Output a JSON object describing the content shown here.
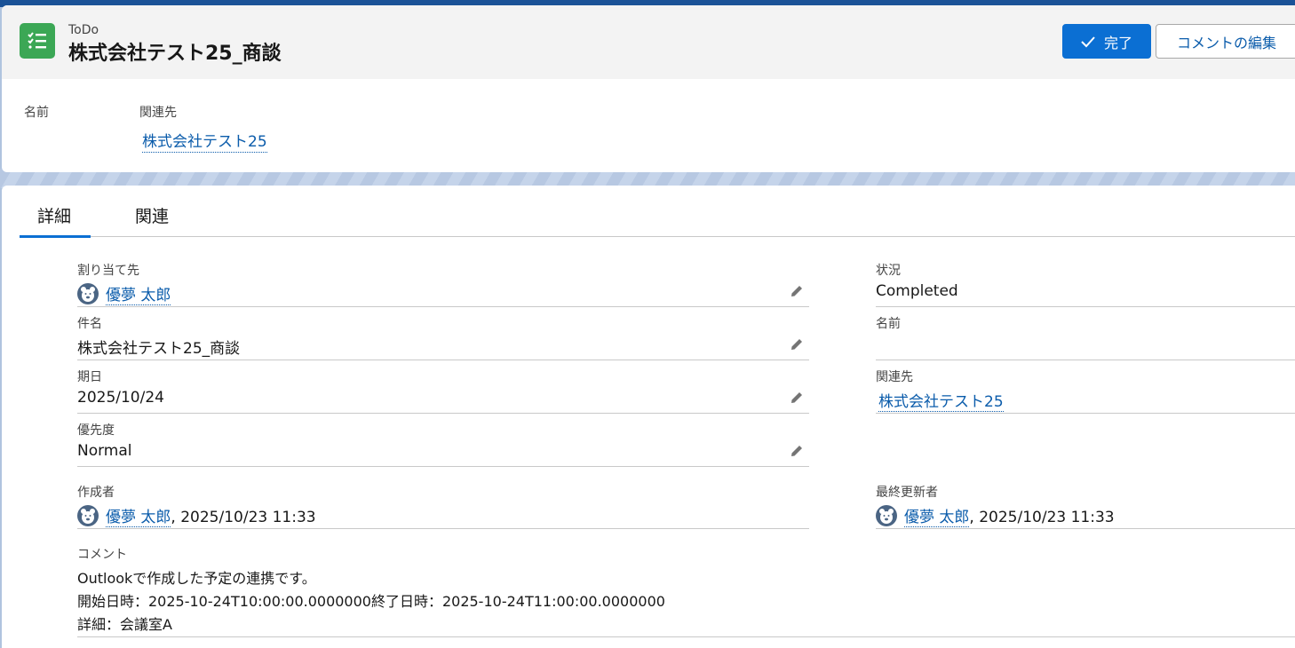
{
  "header": {
    "object_label": "ToDo",
    "title": "株式会社テスト25_商談",
    "buttons": {
      "complete": "完了",
      "edit_comment": "コメントの編集"
    },
    "highlights": {
      "name_label": "名前",
      "related_label": "関連先",
      "related_value": "株式会社テスト25"
    }
  },
  "tabs": [
    {
      "label": "詳細",
      "active": true
    },
    {
      "label": "関連",
      "active": false
    }
  ],
  "fields": {
    "assignee": {
      "label": "割り当て先",
      "value": "優夢 太郎"
    },
    "subject": {
      "label": "件名",
      "value": "株式会社テスト25_商談"
    },
    "due_date": {
      "label": "期日",
      "value": "2025/10/24"
    },
    "priority": {
      "label": "優先度",
      "value": "Normal"
    },
    "status": {
      "label": "状況",
      "value": "Completed"
    },
    "name": {
      "label": "名前",
      "value": ""
    },
    "related": {
      "label": "関連先",
      "value": "株式会社テスト25"
    },
    "created_by": {
      "label": "作成者",
      "user": "優夢 太郎",
      "timestamp": ", 2025/10/23 11:33"
    },
    "modified_by": {
      "label": "最終更新者",
      "user": "優夢 太郎",
      "timestamp": ", 2025/10/23 11:33"
    },
    "comment": {
      "label": "コメント",
      "lines": [
        "Outlookで作成した予定の連携です。",
        "開始日時：2025-10-24T10:00:00.0000000終了日時：2025-10-24T11:00:00.0000000",
        "詳細：会議室A"
      ]
    }
  },
  "colors": {
    "brand": "#0b6fd3",
    "link": "#0b5cab",
    "task_icon": "#3ba755"
  }
}
